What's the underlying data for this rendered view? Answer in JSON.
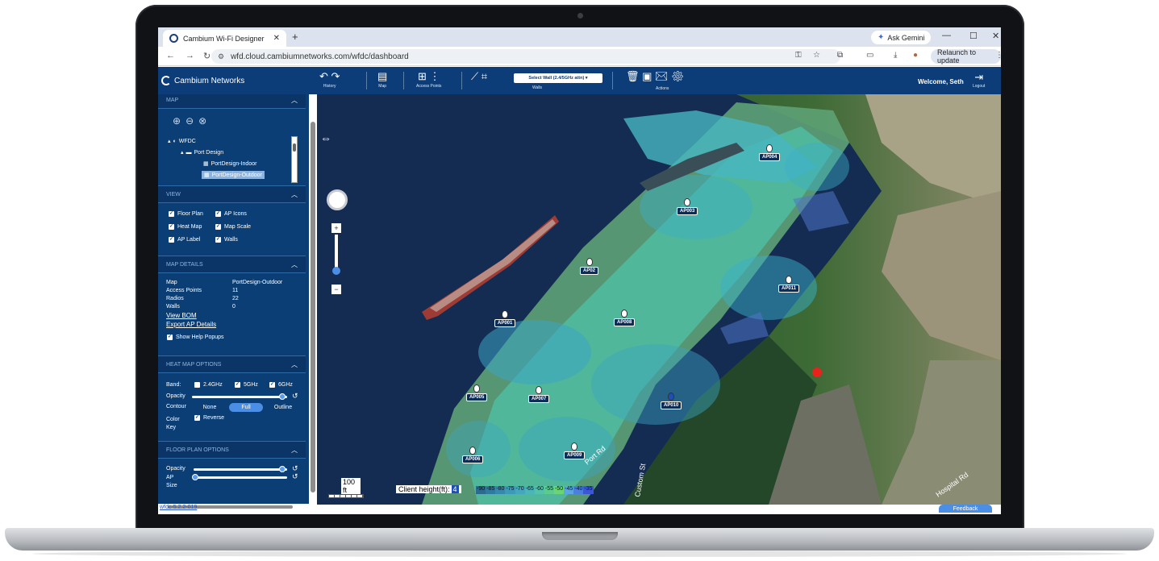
{
  "browser": {
    "tab_title": "Cambium Wi-Fi Designer",
    "tab_close": "✕",
    "new_tab": "+",
    "url": "wfd.cloud.cambiumnetworks.com/wfdc/dashboard",
    "ask_gemini": "Ask Gemini",
    "relaunch": "Relaunch to update",
    "win_min": "—",
    "win_max": "☐",
    "win_close": "✕"
  },
  "app": {
    "brand": "Cambium Networks",
    "toolbar": [
      {
        "label": "History",
        "icon": "undo-redo-icon"
      },
      {
        "label": "Map",
        "icon": "map-icon"
      },
      {
        "label": "Access Points",
        "icon": "access-points-icon"
      },
      {
        "label": "Walls",
        "icon": "walls-icon"
      },
      {
        "label": "Actions",
        "icon": "actions-icon"
      }
    ],
    "wall_select": "Select Wall (2.4/5GHz attn)",
    "welcome": "Welcome, Seth",
    "logout": "Logout"
  },
  "sidebar": {
    "sections": {
      "map": "MAP",
      "view": "VIEW",
      "map_details": "MAP DETAILS",
      "heat_map_options": "HEAT MAP OPTIONS",
      "floor_plan_options": "FLOOR PLAN OPTIONS"
    },
    "tree": {
      "root": "WFDC",
      "folder": "Port Design",
      "item1": "PortDesign-Indoor",
      "item2": "PortDesign-Outdoor"
    },
    "view": {
      "floor_plan": "Floor Plan",
      "ap_icons": "AP Icons",
      "heat_map": "Heat Map",
      "map_scale": "Map Scale",
      "ap_label": "AP Label",
      "walls": "Walls"
    },
    "details": {
      "map_label": "Map",
      "map_value": "PortDesign-Outdoor",
      "ap_label": "Access Points",
      "ap_value": "11",
      "radios_label": "Radios",
      "radios_value": "22",
      "walls_label": "Walls",
      "walls_value": "0",
      "view_bom": "View BOM",
      "export_ap": "Export AP Details",
      "help_popups": "Show Help Popups"
    },
    "heatmap": {
      "band": "Band:",
      "b24": "2.4GHz",
      "b5": "5GHz",
      "b6": "6GHz",
      "b24_checked": false,
      "b5_checked": true,
      "b6_checked": true,
      "opacity": "Opacity",
      "opacity_level": 0.95,
      "contour": "Contour",
      "contour_none": "None",
      "contour_full": "Full",
      "contour_outline": "Outline",
      "contour_selected": "Full",
      "color_key": "Color Key",
      "reverse": "Reverse"
    },
    "floorplan": {
      "opacity": "Opacity",
      "opacity_level": 0.95,
      "ap_size": "AP Size",
      "ap_size_level": 0.02
    }
  },
  "map": {
    "access_points": [
      {
        "label": "AP001"
      },
      {
        "label": "AP02"
      },
      {
        "label": "AP003"
      },
      {
        "label": "AP004"
      },
      {
        "label": "AP005"
      },
      {
        "label": "AP006"
      },
      {
        "label": "AP007"
      },
      {
        "label": "AP008"
      },
      {
        "label": "AP009"
      },
      {
        "label": "AP010"
      },
      {
        "label": "AP011"
      }
    ],
    "scale_label": "100 ft",
    "client_height_label": "Client height(ft):",
    "client_height_value": "4",
    "legend_values": [
      "-90",
      "-85",
      "-80",
      "-75",
      "-70",
      "-65",
      "-60",
      "-55",
      "-50",
      "-45",
      "-40",
      "-35"
    ],
    "legend_colors": [
      "#2a6b8f",
      "#2f7aa0",
      "#3689ae",
      "#3d99b8",
      "#43a8be",
      "#4ab6b8",
      "#52c2a8",
      "#5ccc8e",
      "#6bd478",
      "#5aa6e0",
      "#4a7fe0",
      "#3b57d8"
    ],
    "street_labels": [
      "Port Rd",
      "Custom St",
      "Hospital Rd"
    ]
  },
  "footer": {
    "version": "wfdc-5.2.2-019",
    "feedback": "Feedback"
  }
}
